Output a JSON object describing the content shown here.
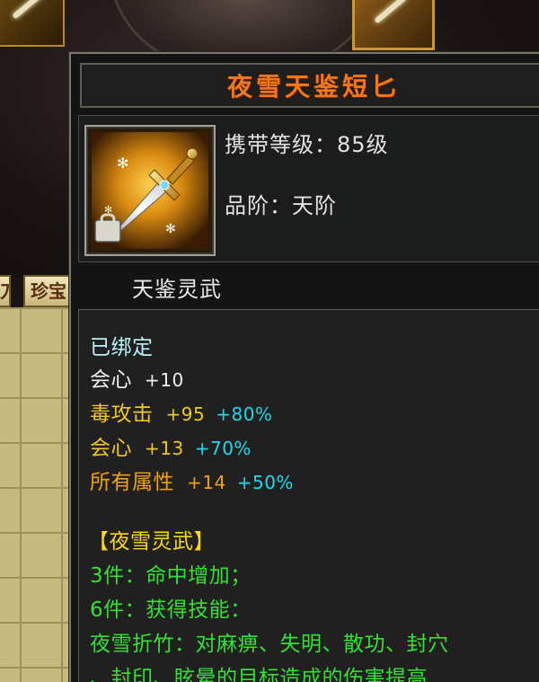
{
  "item": {
    "name": "夜雪天鉴短匕",
    "level_label": "携带等级：85级",
    "grade_label": "品阶：天阶",
    "subtitle": "天鉴灵武"
  },
  "background": {
    "tab_left": "刀",
    "tab_right": "珍宝"
  },
  "attributes": {
    "bound": "已绑定",
    "stats": [
      {
        "name": "会心",
        "value": "+10",
        "percent": "",
        "color": "#eeeeee"
      },
      {
        "name": "毒攻击",
        "value": "+95",
        "percent": "+80%",
        "color": "#f0c820"
      },
      {
        "name": "会心",
        "value": "+13",
        "percent": "+70%",
        "color": "#f0c820"
      },
      {
        "name": "所有属性",
        "value": "+14",
        "percent": "+50%",
        "color": "#f0a018"
      }
    ],
    "set_name": "【夜雪灵武】",
    "set_bonuses": [
      "3件：命中增加；",
      "6件：获得技能：",
      "夜雪折竹：对麻痹、失明、散功、封穴",
      "、封印、眩晕的目标造成的伤害提高"
    ]
  },
  "colors": {
    "title": "#f07818",
    "bound": "#b8f0f8",
    "percent": "#22d8e8",
    "set_name": "#f8d818",
    "set_bonus": "#34e034"
  },
  "icons": {
    "item": "golden-dagger-icon",
    "bound_lock": "lock-badge-icon"
  }
}
